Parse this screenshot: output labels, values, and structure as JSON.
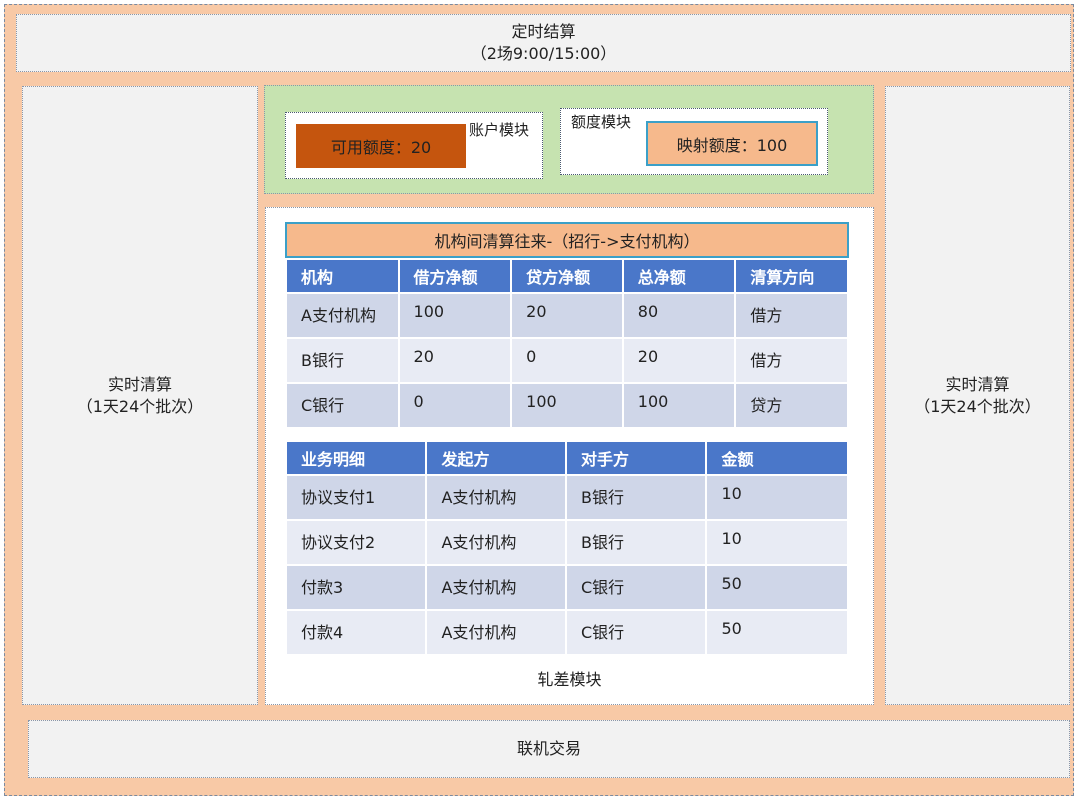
{
  "scheduled": {
    "title": "定时结算",
    "subtitle": "（2场9:00/15:00）"
  },
  "realtime_left": {
    "title": "实时清算",
    "subtitle": "（1天24个批次）"
  },
  "realtime_right": {
    "title": "实时清算",
    "subtitle": "（1天24个批次）"
  },
  "online": {
    "title": "联机交易"
  },
  "account_module": {
    "label": "账户模块",
    "quota": "可用额度：20"
  },
  "quota_module": {
    "label": "额度模块",
    "quota": "映射额度：100"
  },
  "netting_module": {
    "label": "轧差模块",
    "table1": {
      "title": "机构间清算往来-（招行->支付机构）",
      "headers": [
        "机构",
        "借方净额",
        "贷方净额",
        "总净额",
        "清算方向"
      ],
      "rows": [
        [
          "A支付机构",
          "100",
          "20",
          "80",
          "借方"
        ],
        [
          "B银行",
          "20",
          "0",
          "20",
          "借方"
        ],
        [
          "C银行",
          "0",
          "100",
          "100",
          "贷方"
        ]
      ]
    },
    "table2": {
      "headers": [
        "业务明细",
        "发起方",
        "对手方",
        "金额"
      ],
      "rows": [
        [
          "协议支付1",
          "A支付机构",
          "B银行",
          "10"
        ],
        [
          "协议支付2",
          "A支付机构",
          "B银行",
          "10"
        ],
        [
          "付款3",
          "A支付机构",
          "C银行",
          "50"
        ],
        [
          "付款4",
          "A支付机构",
          "C银行",
          "50"
        ]
      ]
    }
  },
  "colors": {
    "outer": "#f8c9a6",
    "green": "#c6e3b0",
    "header": "#4a77c9",
    "quota_dark": "#c5550e",
    "quota_light": "#f6b98c"
  }
}
